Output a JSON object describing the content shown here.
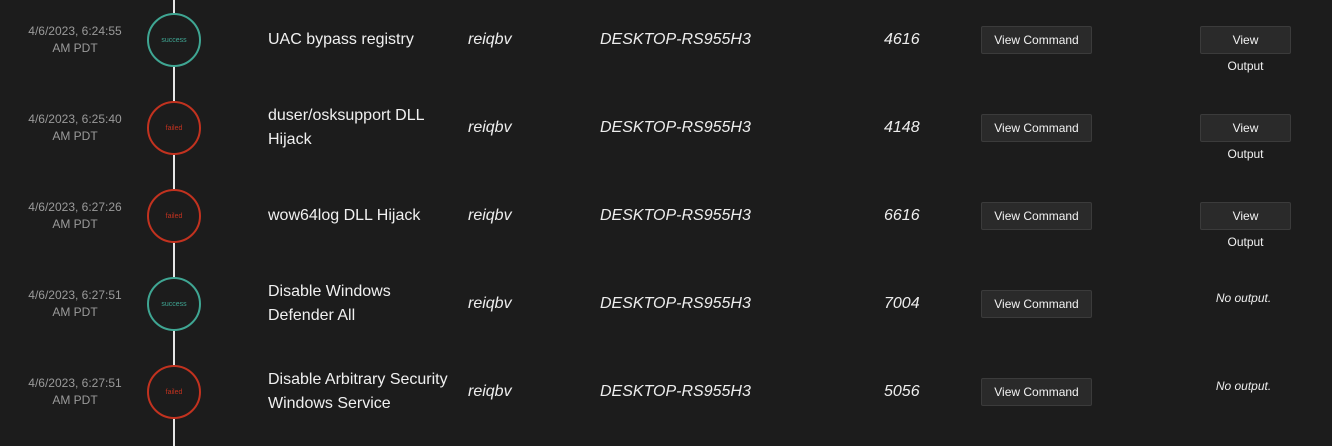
{
  "rows": [
    {
      "date": "4/6/2023, 6:24:55",
      "tz": "AM PDT",
      "status": "success",
      "command": "UAC bypass registry",
      "user": "reiqbv",
      "host": "DESKTOP-RS955H3",
      "pid": "4616",
      "view_command": "View Command",
      "view_output": "View Output",
      "no_output": ""
    },
    {
      "date": "4/6/2023, 6:25:40",
      "tz": "AM PDT",
      "status": "failed",
      "command": "duser/osksupport DLL Hijack",
      "user": "reiqbv",
      "host": "DESKTOP-RS955H3",
      "pid": "4148",
      "view_command": "View Command",
      "view_output": "View Output",
      "no_output": ""
    },
    {
      "date": "4/6/2023, 6:27:26",
      "tz": "AM PDT",
      "status": "failed",
      "command": "wow64log DLL Hijack",
      "user": "reiqbv",
      "host": "DESKTOP-RS955H3",
      "pid": "6616",
      "view_command": "View Command",
      "view_output": "View Output",
      "no_output": ""
    },
    {
      "date": "4/6/2023, 6:27:51",
      "tz": "AM PDT",
      "status": "success",
      "command": "Disable Windows Defender All",
      "user": "reiqbv",
      "host": "DESKTOP-RS955H3",
      "pid": "7004",
      "view_command": "View Command",
      "view_output": "",
      "no_output": "No output."
    },
    {
      "date": "4/6/2023, 6:27:51",
      "tz": "AM PDT",
      "status": "failed",
      "command": "Disable Arbitrary Security Windows Service",
      "user": "reiqbv",
      "host": "DESKTOP-RS955H3",
      "pid": "5056",
      "view_command": "View Command",
      "view_output": "",
      "no_output": "No output."
    }
  ],
  "colors": {
    "success": "#3fa693",
    "failed": "#c2321f",
    "background": "#1c1c1c"
  }
}
